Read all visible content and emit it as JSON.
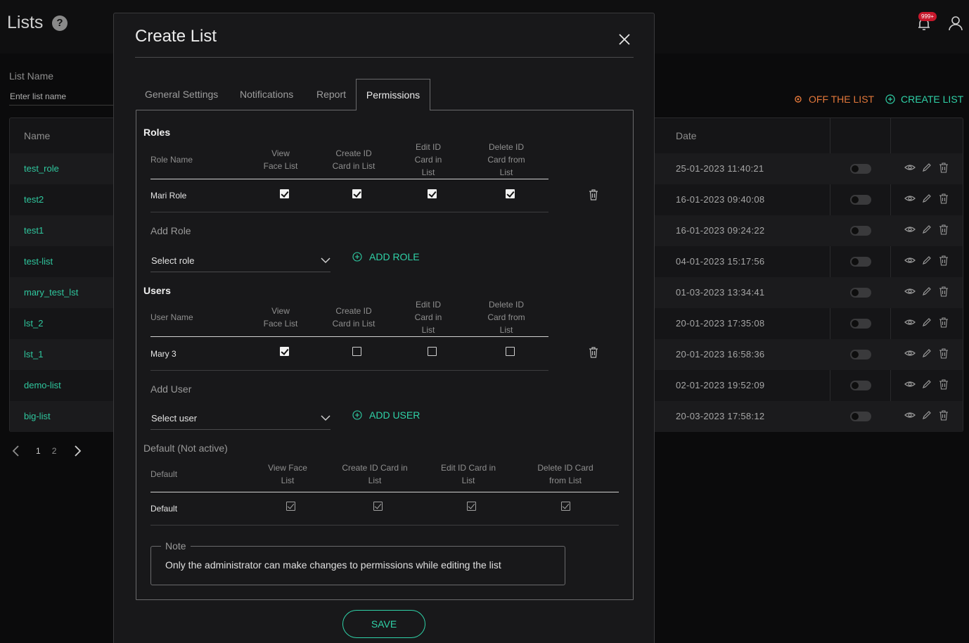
{
  "page": {
    "title": "Lists",
    "notification_badge": "999+",
    "filter_label": "List Name",
    "filter_placeholder": "Enter list name",
    "off_list_label": "OFF THE LIST",
    "create_list_label": "CREATE LIST",
    "table_headers": {
      "name": "Name",
      "date": "Date"
    },
    "rows": [
      {
        "name": "test_role",
        "date": "25-01-2023 11:40:21"
      },
      {
        "name": "test2",
        "date": "16-01-2023 09:40:08"
      },
      {
        "name": "test1",
        "date": "16-01-2023 09:24:22"
      },
      {
        "name": "test-list",
        "date": "04-01-2023 15:17:56"
      },
      {
        "name": "mary_test_lst",
        "date": "01-03-2023 13:34:41"
      },
      {
        "name": "lst_2",
        "date": "20-01-2023 17:35:08"
      },
      {
        "name": "lst_1",
        "date": "20-01-2023 16:58:36"
      },
      {
        "name": "demo-list",
        "date": "02-01-2023 19:52:09"
      },
      {
        "name": "big-list",
        "date": "20-03-2023 17:58:12"
      }
    ],
    "pagination": [
      "1",
      "2"
    ]
  },
  "modal": {
    "title": "Create List",
    "tabs": [
      "General Settings",
      "Notifications",
      "Report",
      "Permissions"
    ],
    "active_tab": "Permissions",
    "roles": {
      "title": "Roles",
      "headers": {
        "name": "Role Name",
        "view": "View\nFace List",
        "create": "Create ID\nCard in List",
        "edit": "Edit ID\nCard in\nList",
        "delete": "Delete ID\nCard from\nList"
      },
      "row": {
        "name": "Mari Role",
        "view": true,
        "create": true,
        "edit": true,
        "delete": true
      },
      "add_label": "Add Role",
      "select_value": "Select role",
      "add_button": "ADD ROLE"
    },
    "users": {
      "title": "Users",
      "headers": {
        "name": "User Name",
        "view": "View\nFace List",
        "create": "Create ID\nCard in List",
        "edit": "Edit ID\nCard in\nList",
        "delete": "Delete ID\nCard from\nList"
      },
      "row": {
        "name": "Mary 3",
        "view": true,
        "create": false,
        "edit": false,
        "delete": false
      },
      "add_label": "Add User",
      "select_value": "Select user",
      "add_button": "ADD USER"
    },
    "default": {
      "title": "Default (Not active)",
      "headers": {
        "name": "Default",
        "view": "View Face\nList",
        "create": "Create ID Card in\nList",
        "edit": "Edit ID Card in\nList",
        "delete": "Delete ID Card\nfrom List"
      },
      "row": {
        "name": "Default",
        "view": true,
        "create": true,
        "edit": true,
        "delete": true
      }
    },
    "note": {
      "legend": "Note",
      "text": "Only the administrator can make changes to permissions while editing the list"
    },
    "save_label": "SAVE"
  }
}
